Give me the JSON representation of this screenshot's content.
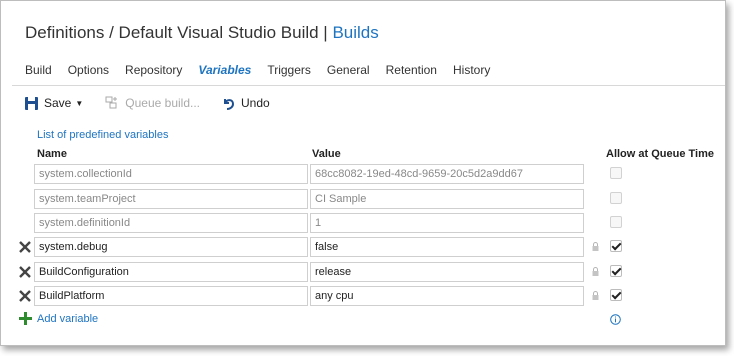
{
  "header": {
    "breadcrumb_prefix": "Definitions / Default Visual Studio Build |",
    "current": "Builds"
  },
  "tabs": [
    {
      "label": "Build"
    },
    {
      "label": "Options"
    },
    {
      "label": "Repository"
    },
    {
      "label": "Variables",
      "active": true
    },
    {
      "label": "Triggers"
    },
    {
      "label": "General"
    },
    {
      "label": "Retention"
    },
    {
      "label": "History"
    }
  ],
  "toolbar": {
    "save_label": "Save",
    "queue_label": "Queue build...",
    "undo_label": "Undo"
  },
  "predefined_link": "List of predefined variables",
  "columns": {
    "name": "Name",
    "value": "Value",
    "allow": "Allow at Queue Time"
  },
  "variables": [
    {
      "name": "system.collectionId",
      "value": "68cc8082-19ed-48cd-9659-20c5d2a9dd67",
      "readonly": true,
      "allow_queue_time": false
    },
    {
      "name": "system.teamProject",
      "value": "CI Sample",
      "readonly": true,
      "allow_queue_time": false
    },
    {
      "name": "system.definitionId",
      "value": "1",
      "readonly": true,
      "allow_queue_time": false
    },
    {
      "name": "system.debug",
      "value": "false",
      "readonly": false,
      "allow_queue_time": true
    },
    {
      "name": "BuildConfiguration",
      "value": "release",
      "readonly": false,
      "allow_queue_time": true
    },
    {
      "name": "BuildPlatform",
      "value": "any cpu",
      "readonly": false,
      "allow_queue_time": true
    }
  ],
  "add_variable": "Add variable",
  "colors": {
    "accent": "#1e74c1",
    "add_green": "#2e8b2e"
  }
}
